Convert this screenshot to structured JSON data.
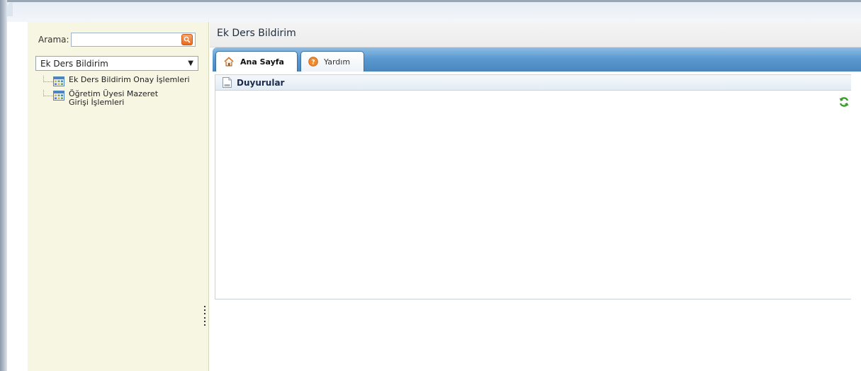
{
  "sidebar": {
    "search_label": "Arama:",
    "search_value": "",
    "module_selected": "Ek Ders Bildirim",
    "tree_items": [
      {
        "label": "Ek Ders Bildirim Onay İşlemleri"
      },
      {
        "label": "Öğretim Üyesi Mazeret Girişi İşlemleri"
      }
    ]
  },
  "main": {
    "title": "Ek Ders Bildirim",
    "tabs": [
      {
        "label": "Ana Sayfa",
        "icon": "home-icon",
        "active": true
      },
      {
        "label": "Yardım",
        "icon": "help-icon",
        "active": false
      }
    ],
    "panel": {
      "title": "Duyurular",
      "icon": "document-icon"
    }
  },
  "colors": {
    "sidebar_bg": "#f6f6e2",
    "tabbar_blue": "#5a9ad1",
    "search_button": "#e86a1e",
    "refresh_green": "#3a9b2a"
  }
}
